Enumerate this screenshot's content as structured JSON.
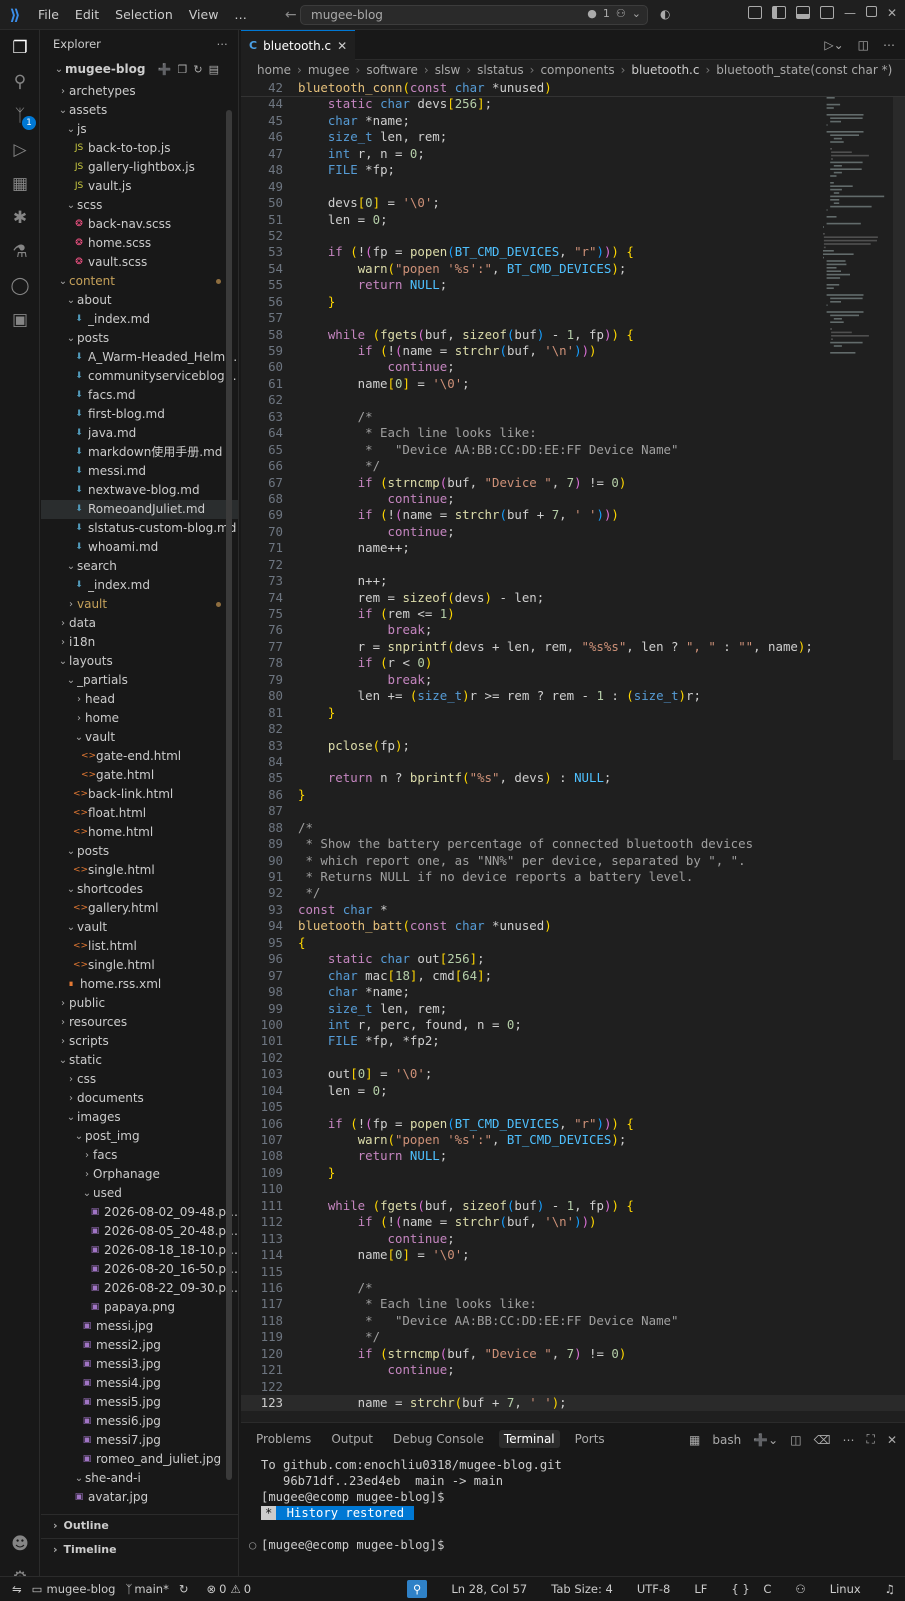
{
  "menu": [
    "File",
    "Edit",
    "Selection",
    "View",
    "…"
  ],
  "command_center": {
    "text": "mugee-blog",
    "changes": "1"
  },
  "explorer": {
    "title": "Explorer",
    "root": "mugee-blog",
    "outline": "Outline",
    "timeline": "Timeline"
  },
  "tree": [
    {
      "d": 1,
      "t": "f",
      "n": "archetypes"
    },
    {
      "d": 1,
      "t": "o",
      "n": "assets"
    },
    {
      "d": 2,
      "t": "o",
      "n": "js"
    },
    {
      "d": 3,
      "t": "js",
      "n": "back-to-top.js"
    },
    {
      "d": 3,
      "t": "js",
      "n": "gallery-lightbox.js"
    },
    {
      "d": 3,
      "t": "js",
      "n": "vault.js"
    },
    {
      "d": 2,
      "t": "o",
      "n": "scss"
    },
    {
      "d": 3,
      "t": "scss",
      "n": "back-nav.scss"
    },
    {
      "d": 3,
      "t": "scss",
      "n": "home.scss"
    },
    {
      "d": 3,
      "t": "scss",
      "n": "vault.scss"
    },
    {
      "d": 1,
      "t": "o",
      "n": "content",
      "mod": true
    },
    {
      "d": 2,
      "t": "o",
      "n": "about"
    },
    {
      "d": 3,
      "t": "md",
      "n": "_index.md"
    },
    {
      "d": 2,
      "t": "o",
      "n": "posts"
    },
    {
      "d": 3,
      "t": "md",
      "n": "A_Warm-Headed_Helms..."
    },
    {
      "d": 3,
      "t": "md",
      "n": "communityserviceblog.md"
    },
    {
      "d": 3,
      "t": "md",
      "n": "facs.md"
    },
    {
      "d": 3,
      "t": "md",
      "n": "first-blog.md"
    },
    {
      "d": 3,
      "t": "md",
      "n": "java.md"
    },
    {
      "d": 3,
      "t": "md",
      "n": "markdown使用手册.md"
    },
    {
      "d": 3,
      "t": "md",
      "n": "messi.md"
    },
    {
      "d": 3,
      "t": "md",
      "n": "nextwave-blog.md"
    },
    {
      "d": 3,
      "t": "md",
      "n": "RomeoandJuliet.md",
      "sel": true
    },
    {
      "d": 3,
      "t": "md",
      "n": "slstatus-custom-blog.md"
    },
    {
      "d": 3,
      "t": "md",
      "n": "whoami.md"
    },
    {
      "d": 2,
      "t": "o",
      "n": "search"
    },
    {
      "d": 3,
      "t": "md",
      "n": "_index.md"
    },
    {
      "d": 2,
      "t": "f",
      "n": "vault",
      "mod": true
    },
    {
      "d": 1,
      "t": "f",
      "n": "data"
    },
    {
      "d": 1,
      "t": "f",
      "n": "i18n"
    },
    {
      "d": 1,
      "t": "o",
      "n": "layouts"
    },
    {
      "d": 2,
      "t": "o",
      "n": "_partials"
    },
    {
      "d": 3,
      "t": "f",
      "n": "head"
    },
    {
      "d": 3,
      "t": "f",
      "n": "home"
    },
    {
      "d": 3,
      "t": "o",
      "n": "vault"
    },
    {
      "d": 4,
      "t": "html",
      "n": "gate-end.html"
    },
    {
      "d": 4,
      "t": "html",
      "n": "gate.html"
    },
    {
      "d": 3,
      "t": "html",
      "n": "back-link.html"
    },
    {
      "d": 3,
      "t": "html",
      "n": "float.html"
    },
    {
      "d": 3,
      "t": "html",
      "n": "home.html"
    },
    {
      "d": 2,
      "t": "o",
      "n": "posts"
    },
    {
      "d": 3,
      "t": "html",
      "n": "single.html"
    },
    {
      "d": 2,
      "t": "o",
      "n": "shortcodes"
    },
    {
      "d": 3,
      "t": "html",
      "n": "gallery.html"
    },
    {
      "d": 2,
      "t": "o",
      "n": "vault"
    },
    {
      "d": 3,
      "t": "html",
      "n": "list.html"
    },
    {
      "d": 3,
      "t": "html",
      "n": "single.html"
    },
    {
      "d": 2,
      "t": "rss",
      "n": "home.rss.xml"
    },
    {
      "d": 1,
      "t": "f",
      "n": "public"
    },
    {
      "d": 1,
      "t": "f",
      "n": "resources"
    },
    {
      "d": 1,
      "t": "f",
      "n": "scripts"
    },
    {
      "d": 1,
      "t": "o",
      "n": "static"
    },
    {
      "d": 2,
      "t": "f",
      "n": "css"
    },
    {
      "d": 2,
      "t": "f",
      "n": "documents"
    },
    {
      "d": 2,
      "t": "o",
      "n": "images"
    },
    {
      "d": 3,
      "t": "o",
      "n": "post_img"
    },
    {
      "d": 4,
      "t": "f",
      "n": "facs"
    },
    {
      "d": 4,
      "t": "f",
      "n": "Orphanage"
    },
    {
      "d": 4,
      "t": "o",
      "n": "used"
    },
    {
      "d": 5,
      "t": "img",
      "n": "2026-08-02_09-48.png"
    },
    {
      "d": 5,
      "t": "img",
      "n": "2026-08-05_20-48.png"
    },
    {
      "d": 5,
      "t": "img",
      "n": "2026-08-18_18-10.png"
    },
    {
      "d": 5,
      "t": "img",
      "n": "2026-08-20_16-50.png"
    },
    {
      "d": 5,
      "t": "img",
      "n": "2026-08-22_09-30.png"
    },
    {
      "d": 5,
      "t": "img",
      "n": "papaya.png"
    },
    {
      "d": 4,
      "t": "img",
      "n": "messi.jpg"
    },
    {
      "d": 4,
      "t": "img",
      "n": "messi2.jpg"
    },
    {
      "d": 4,
      "t": "img",
      "n": "messi3.jpg"
    },
    {
      "d": 4,
      "t": "img",
      "n": "messi4.jpg"
    },
    {
      "d": 4,
      "t": "img",
      "n": "messi5.jpg"
    },
    {
      "d": 4,
      "t": "img",
      "n": "messi6.jpg"
    },
    {
      "d": 4,
      "t": "img",
      "n": "messi7.jpg"
    },
    {
      "d": 4,
      "t": "img",
      "n": "romeo_and_juliet.jpg"
    },
    {
      "d": 3,
      "t": "o",
      "n": "she-and-i"
    },
    {
      "d": 3,
      "t": "img",
      "n": "avatar.jpg"
    }
  ],
  "tab": {
    "label": "bluetooth.c",
    "lang": "C"
  },
  "breadcrumbs": [
    "home",
    "mugee",
    "software",
    "slsw",
    "slstatus",
    "components",
    "bluetooth.c",
    "bluetooth_state(const char *)"
  ],
  "sticky": {
    "text": "bluetooth_conn(const char *unused)"
  },
  "code": [
    [
      42,
      "bluetooth_conn(const char *unused)"
    ],
    [
      43,
      "    static char devs[256];"
    ],
    [
      44,
      "    char *name;"
    ],
    [
      45,
      "    size_t len, rem;"
    ],
    [
      46,
      "    int r, n = 0;"
    ],
    [
      47,
      "    FILE *fp;"
    ],
    [
      48,
      ""
    ],
    [
      49,
      "    devs[0] = '\\0';"
    ],
    [
      50,
      "    len = 0;"
    ],
    [
      51,
      ""
    ],
    [
      52,
      "    if (!(fp = popen(BT_CMD_DEVICES, \"r\"))) {"
    ],
    [
      53,
      "        warn(\"popen '%s':\", BT_CMD_DEVICES);"
    ],
    [
      54,
      "        return NULL;"
    ],
    [
      55,
      "    }"
    ],
    [
      56,
      ""
    ],
    [
      57,
      "    while (fgets(buf, sizeof(buf) - 1, fp)) {"
    ],
    [
      58,
      "        if (!(name = strchr(buf, '\\n')))"
    ],
    [
      59,
      "            continue;"
    ],
    [
      60,
      "        name[0] = '\\0';"
    ],
    [
      61,
      ""
    ],
    [
      62,
      "        /*"
    ],
    [
      63,
      "         * Each line looks like:"
    ],
    [
      64,
      "         *   \"Device AA:BB:CC:DD:EE:FF Device Name\""
    ],
    [
      65,
      "         */"
    ],
    [
      66,
      "        if (strncmp(buf, \"Device \", 7) != 0)"
    ],
    [
      67,
      "            continue;"
    ],
    [
      68,
      "        if (!(name = strchr(buf + 7, ' ')))"
    ],
    [
      69,
      "            continue;"
    ],
    [
      70,
      "        name++;"
    ],
    [
      71,
      ""
    ],
    [
      72,
      "        n++;"
    ],
    [
      73,
      "        rem = sizeof(devs) - len;"
    ],
    [
      74,
      "        if (rem <= 1)"
    ],
    [
      75,
      "            break;"
    ],
    [
      76,
      "        r = snprintf(devs + len, rem, \"%s%s\", len ? \", \" : \"\", name);"
    ],
    [
      77,
      "        if (r < 0)"
    ],
    [
      78,
      "            break;"
    ],
    [
      79,
      "        len += (size_t)r >= rem ? rem - 1 : (size_t)r;"
    ],
    [
      80,
      "    }"
    ],
    [
      81,
      ""
    ],
    [
      82,
      "    pclose(fp);"
    ],
    [
      83,
      ""
    ],
    [
      84,
      "    return n ? bprintf(\"%s\", devs) : NULL;"
    ],
    [
      85,
      "}"
    ],
    [
      86,
      ""
    ],
    [
      87,
      "/*"
    ],
    [
      88,
      " * Show the battery percentage of connected bluetooth devices"
    ],
    [
      89,
      " * which report one, as \"NN%\" per device, separated by \", \"."
    ],
    [
      90,
      " * Returns NULL if no device reports a battery level."
    ],
    [
      91,
      " */"
    ],
    [
      92,
      "const char *"
    ],
    [
      93,
      "bluetooth_batt(const char *unused)"
    ],
    [
      94,
      "{"
    ],
    [
      95,
      "    static char out[256];"
    ],
    [
      96,
      "    char mac[18], cmd[64];"
    ],
    [
      97,
      "    char *name;"
    ],
    [
      98,
      "    size_t len, rem;"
    ],
    [
      99,
      "    int r, perc, found, n = 0;"
    ],
    [
      100,
      "    FILE *fp, *fp2;"
    ],
    [
      101,
      ""
    ],
    [
      102,
      "    out[0] = '\\0';"
    ],
    [
      103,
      "    len = 0;"
    ],
    [
      104,
      ""
    ],
    [
      105,
      "    if (!(fp = popen(BT_CMD_DEVICES, \"r\"))) {"
    ],
    [
      106,
      "        warn(\"popen '%s':\", BT_CMD_DEVICES);"
    ],
    [
      107,
      "        return NULL;"
    ],
    [
      108,
      "    }"
    ],
    [
      109,
      ""
    ],
    [
      110,
      "    while (fgets(buf, sizeof(buf) - 1, fp)) {"
    ],
    [
      111,
      "        if (!(name = strchr(buf, '\\n')))"
    ],
    [
      112,
      "            continue;"
    ],
    [
      113,
      "        name[0] = '\\0';"
    ],
    [
      114,
      ""
    ],
    [
      115,
      "        /*"
    ],
    [
      116,
      "         * Each line looks like:"
    ],
    [
      117,
      "         *   \"Device AA:BB:CC:DD:EE:FF Device Name\""
    ],
    [
      118,
      "         */"
    ],
    [
      119,
      "        if (strncmp(buf, \"Device \", 7) != 0)"
    ],
    [
      120,
      "            continue;"
    ],
    [
      121,
      ""
    ],
    [
      122,
      "        name = strchr(buf + 7, ' ');"
    ]
  ],
  "panel": {
    "tabs": [
      "Problems",
      "Output",
      "Debug Console",
      "Terminal",
      "Ports"
    ],
    "active": "Terminal",
    "shell": "bash"
  },
  "terminal": [
    "To github.com:enochliu0318/mugee-blog.git",
    "   96b71df..23ed4eb  main -> main",
    "[mugee@ecomp mugee-blog]$",
    "",
    "",
    "[mugee@ecomp mugee-blog]$"
  ],
  "terminal_history": {
    "star": "*",
    "text": " History restored "
  },
  "status": {
    "repo": "mugee-blog",
    "branch": "main*",
    "errors": "0",
    "warnings": "0",
    "position": "Ln 28, Col 57",
    "tabsize": "Tab Size: 4",
    "encoding": "UTF-8",
    "eol": "LF",
    "lang": "C",
    "os": "Linux"
  },
  "colors": {
    "accent": "#0078d4",
    "folder_mod": "#c5a15a"
  }
}
